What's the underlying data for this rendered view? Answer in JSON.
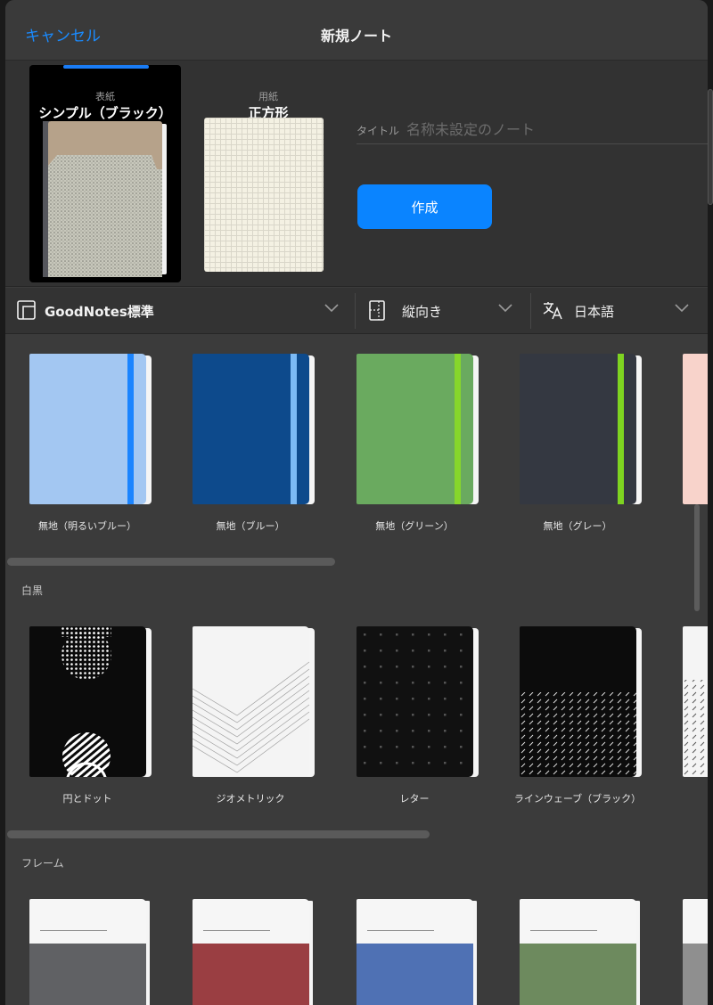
{
  "nav": {
    "cancel": "キャンセル",
    "title": "新規ノート"
  },
  "config": {
    "cover_label": "表紙",
    "cover_value": "シンプル（ブラック）",
    "paper_label": "用紙",
    "paper_value": "正方形",
    "title_label": "タイトル",
    "title_placeholder": "名称未設定のノート",
    "create": "作成"
  },
  "filters": {
    "template_set": "GoodNotes標準",
    "orientation": "縦向き",
    "language": "日本語"
  },
  "sections": {
    "plain": {
      "items": [
        {
          "label": "無地（明るいブルー）",
          "color": "#a3c7f2",
          "band": "#1a84ff"
        },
        {
          "label": "無地（ブルー）",
          "color": "#0d4a8c",
          "band": "#7cbaf5"
        },
        {
          "label": "無地（グリーン）",
          "color": "#6aaa5f",
          "band": "#86d62b"
        },
        {
          "label": "無地（グレー）",
          "color": "#343841",
          "band": "#7ed321"
        }
      ]
    },
    "mono": {
      "title": "白黒",
      "items": [
        {
          "label": "円とドット"
        },
        {
          "label": "ジオメトリック"
        },
        {
          "label": "レター"
        },
        {
          "label": "ラインウェーブ（ブラック）"
        }
      ]
    },
    "frame": {
      "title": "フレーム",
      "items": [
        {
          "color": "#606164"
        },
        {
          "color": "#9a3e42"
        },
        {
          "color": "#4f71b4"
        },
        {
          "color": "#6d8a5e"
        }
      ]
    }
  },
  "colors": {
    "accent": "#0a84ff",
    "sheet": "#3b3b3b"
  }
}
